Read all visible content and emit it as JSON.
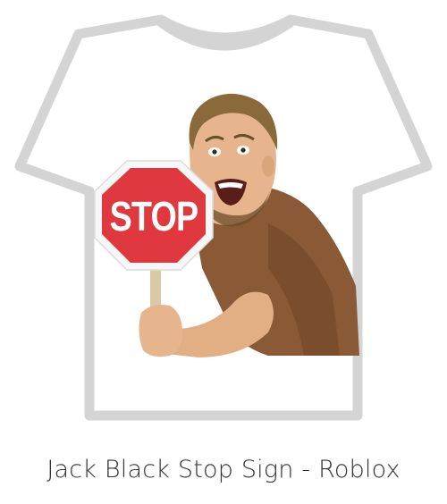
{
  "caption": "Jack Black Stop Sign - Roblox",
  "sign": {
    "text": "STOP"
  },
  "colors": {
    "shirt_outline": "#d4d4d4",
    "shirt_fill": "#ffffff",
    "sign_red": "#e0383f",
    "sign_border": "#f7f7f7",
    "skin": "#e6b58d",
    "tshirt_brown": "#8a5a36",
    "hair": "#8a6a3a",
    "beard": "#6b4e2a"
  },
  "icons": {
    "shirt": "tshirt-outline",
    "sign": "stop-sign-octagon"
  }
}
